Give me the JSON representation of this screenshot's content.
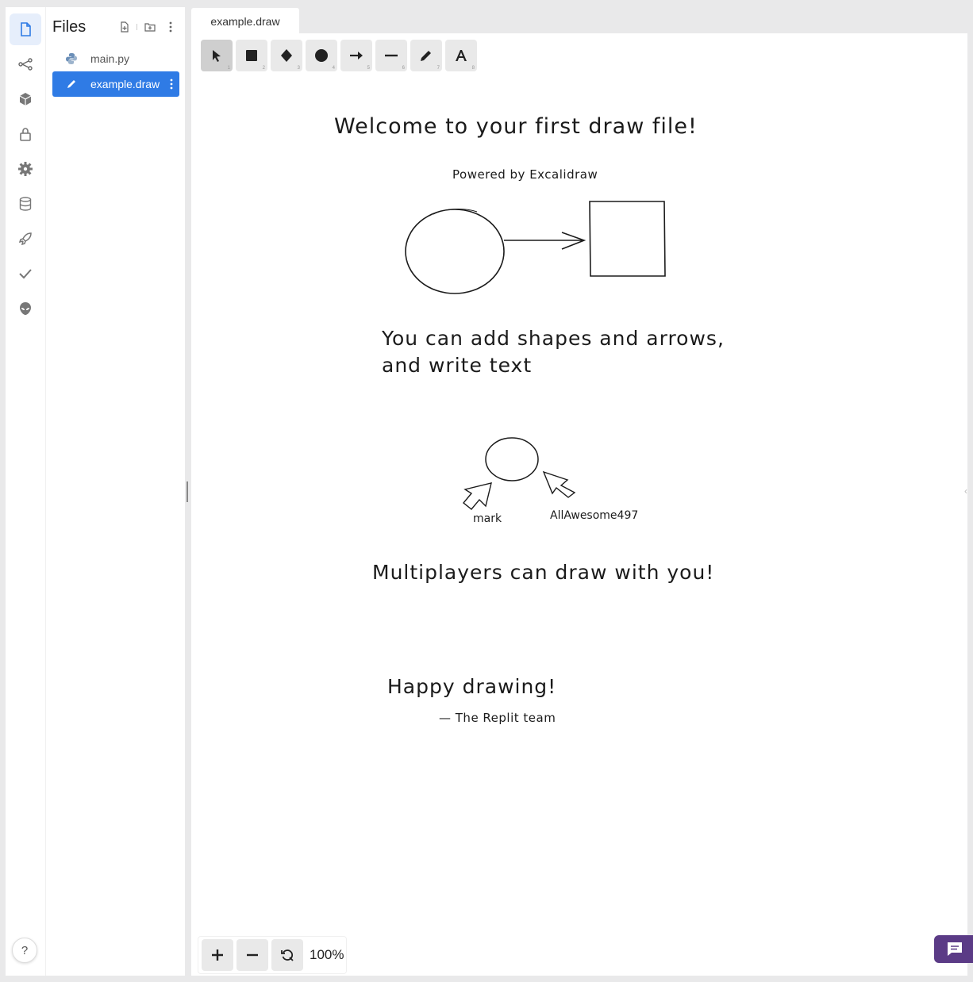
{
  "sidebar": {
    "items": [
      {
        "name": "files",
        "icon": "file-icon",
        "active": true
      },
      {
        "name": "version-control",
        "icon": "git-branch-icon"
      },
      {
        "name": "packages",
        "icon": "cube-icon"
      },
      {
        "name": "secrets",
        "icon": "lock-icon"
      },
      {
        "name": "settings",
        "icon": "gear-icon"
      },
      {
        "name": "database",
        "icon": "database-icon"
      },
      {
        "name": "deploy",
        "icon": "rocket-icon"
      },
      {
        "name": "tests",
        "icon": "check-icon"
      },
      {
        "name": "debugger",
        "icon": "alien-icon"
      }
    ],
    "help_label": "?"
  },
  "files_panel": {
    "title": "Files",
    "files": [
      {
        "name": "main.py",
        "icon": "python-icon",
        "selected": false
      },
      {
        "name": "example.draw",
        "icon": "pencil-icon",
        "selected": true
      }
    ]
  },
  "editor": {
    "tab_label": "example.draw",
    "tools": [
      {
        "name": "selection",
        "shortcut": "1"
      },
      {
        "name": "rectangle",
        "shortcut": "2"
      },
      {
        "name": "diamond",
        "shortcut": "3"
      },
      {
        "name": "ellipse",
        "shortcut": "4"
      },
      {
        "name": "arrow",
        "shortcut": "5"
      },
      {
        "name": "line",
        "shortcut": "6"
      },
      {
        "name": "draw",
        "shortcut": "7"
      },
      {
        "name": "text",
        "shortcut": "8"
      }
    ],
    "zoom_level": "100%"
  },
  "drawing": {
    "welcome": "Welcome to your first draw file!",
    "powered_by": "Powered by Excalidraw",
    "shapes_line1": "You can add shapes and arrows,",
    "shapes_line2": "and write text",
    "user1": "mark",
    "user2": "AllAwesome497",
    "multiplayer": "Multiplayers can draw with you!",
    "happy": "Happy drawing!",
    "signature": "— The Replit team"
  },
  "colors": {
    "accent": "#2f7be5",
    "chat": "#5b3b86",
    "ink": "#1b1b1b"
  }
}
